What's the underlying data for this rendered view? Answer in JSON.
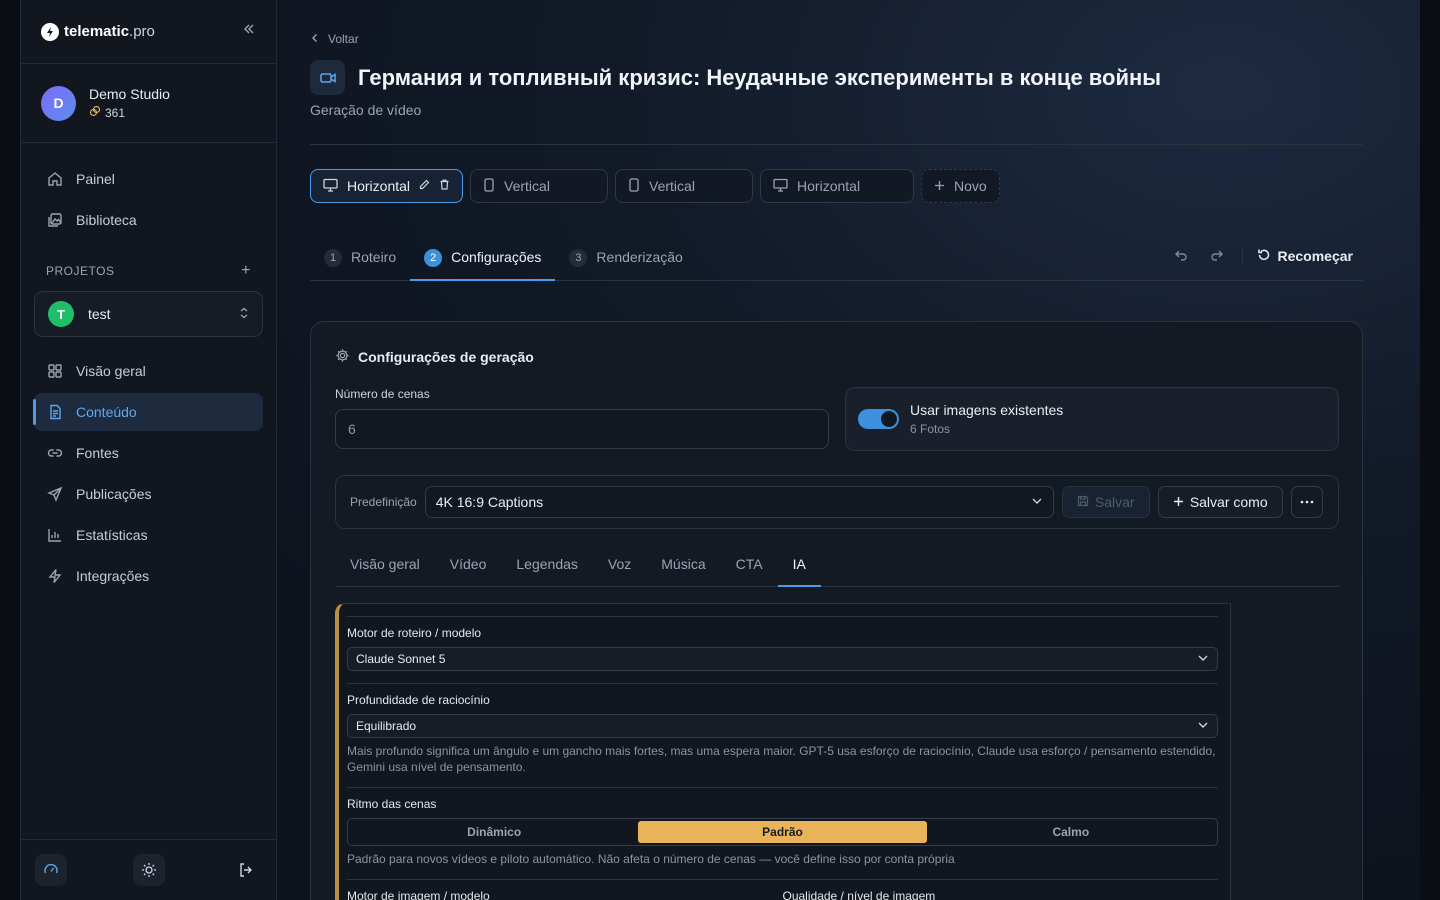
{
  "brand": {
    "name": "telematic",
    "suffix": ".pro"
  },
  "account": {
    "initial": "D",
    "name": "Demo Studio",
    "credits": "361"
  },
  "nav_main": [
    {
      "label": "Painel",
      "icon": "home-icon"
    },
    {
      "label": "Biblioteca",
      "icon": "image-icon"
    }
  ],
  "projects": {
    "heading": "PROJETOS",
    "selected_initial": "T",
    "selected_name": "test"
  },
  "nav_project": [
    {
      "label": "Visão geral",
      "icon": "grid-icon"
    },
    {
      "label": "Conteúdo",
      "icon": "document-icon",
      "active": true
    },
    {
      "label": "Fontes",
      "icon": "link-icon"
    },
    {
      "label": "Publicações",
      "icon": "send-icon"
    },
    {
      "label": "Estatísticas",
      "icon": "bar-chart-icon"
    },
    {
      "label": "Integrações",
      "icon": "bolt-icon"
    }
  ],
  "header": {
    "back_label": "Voltar",
    "title": "Германия и топливный кризис: Неудачные эксперименты в конце войны",
    "subtitle": "Geração de vídeo"
  },
  "variants": [
    {
      "label": "Horizontal",
      "icon": "monitor-icon",
      "active": true
    },
    {
      "label": "Vertical",
      "icon": "phone-icon"
    },
    {
      "label": "Vertical",
      "icon": "phone-icon"
    },
    {
      "label": "Horizontal",
      "icon": "monitor-icon"
    },
    {
      "label": "Novo",
      "icon": "plus-icon"
    }
  ],
  "steps": [
    {
      "num": "1",
      "label": "Roteiro"
    },
    {
      "num": "2",
      "label": "Configurações",
      "active": true
    },
    {
      "num": "3",
      "label": "Renderização"
    }
  ],
  "restart_label": "Recomeçar",
  "settings": {
    "title": "Configurações de geração",
    "scenes_label": "Número de cenas",
    "scenes_value": "6",
    "use_images_title": "Usar imagens existentes",
    "use_images_sub": "6 Fotos",
    "use_images_on": true
  },
  "preset": {
    "label": "Predefinição",
    "value": "4K 16:9 Captions",
    "save_label": "Salvar",
    "save_as_label": "Salvar como"
  },
  "subtabs": [
    "Visão geral",
    "Vídeo",
    "Legendas",
    "Voz",
    "Música",
    "CTA",
    "IA"
  ],
  "active_subtab": "IA",
  "ai": {
    "script_engine_label": "Motor de roteiro / modelo",
    "script_engine_value": "Claude Sonnet 5",
    "reasoning_label": "Profundidade de raciocínio",
    "reasoning_value": "Equilibrado",
    "reasoning_help": "Mais profundo significa um ângulo e um gancho mais fortes, mas uma espera maior. GPT-5 usa esforço de raciocínio, Claude usa esforço / pensamento estendido, Gemini usa nível de pensamento.",
    "pace_label": "Ritmo das cenas",
    "pace_options": [
      "Dinâmico",
      "Padrão",
      "Calmo"
    ],
    "pace_selected": "Padrão",
    "pace_help": "Padrão para novos vídeos e piloto automático. Não afeta o número de cenas — você define isso por conta própria",
    "image_engine_label": "Motor de imagem / modelo",
    "image_quality_label": "Qualidade / nível de imagem"
  },
  "colors": {
    "accent": "#4c9be8",
    "highlight": "#e9b35a",
    "panel_bar": "#b9913e"
  }
}
